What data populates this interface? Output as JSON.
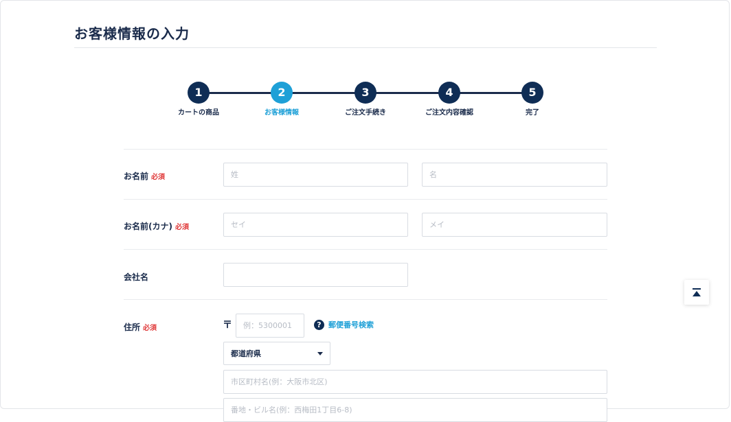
{
  "page": {
    "title": "お客様情報の入力"
  },
  "stepper": {
    "steps": [
      {
        "number": "1",
        "label": "カートの商品"
      },
      {
        "number": "2",
        "label": "お客様情報"
      },
      {
        "number": "3",
        "label": "ご注文手続き"
      },
      {
        "number": "4",
        "label": "ご注文内容確認"
      },
      {
        "number": "5",
        "label": "完了"
      }
    ],
    "active_step": "2"
  },
  "form": {
    "required_label": "必須",
    "name": {
      "label": "お名前",
      "last_placeholder": "姓",
      "first_placeholder": "名"
    },
    "kana": {
      "label": "お名前(カナ)",
      "last_placeholder": "セイ",
      "first_placeholder": "メイ"
    },
    "company": {
      "label": "会社名"
    },
    "address": {
      "label": "住所",
      "postal_mark": "〒",
      "postal_placeholder": "例：5300001",
      "postal_search": "郵便番号検索",
      "help_icon": "?",
      "prefecture_value": "都道府県",
      "city_placeholder": "市区町村名(例：大阪市北区)",
      "street_placeholder": "番地・ビル名(例：西梅田1丁目6-8)"
    }
  },
  "icons": {
    "to_top": "arrow-to-top-icon",
    "help": "question-circle-icon",
    "select": "caret-down-icon"
  },
  "colors": {
    "navy": "#0f2d55",
    "accent": "#1ea0d7",
    "required": "#e03c3c"
  }
}
